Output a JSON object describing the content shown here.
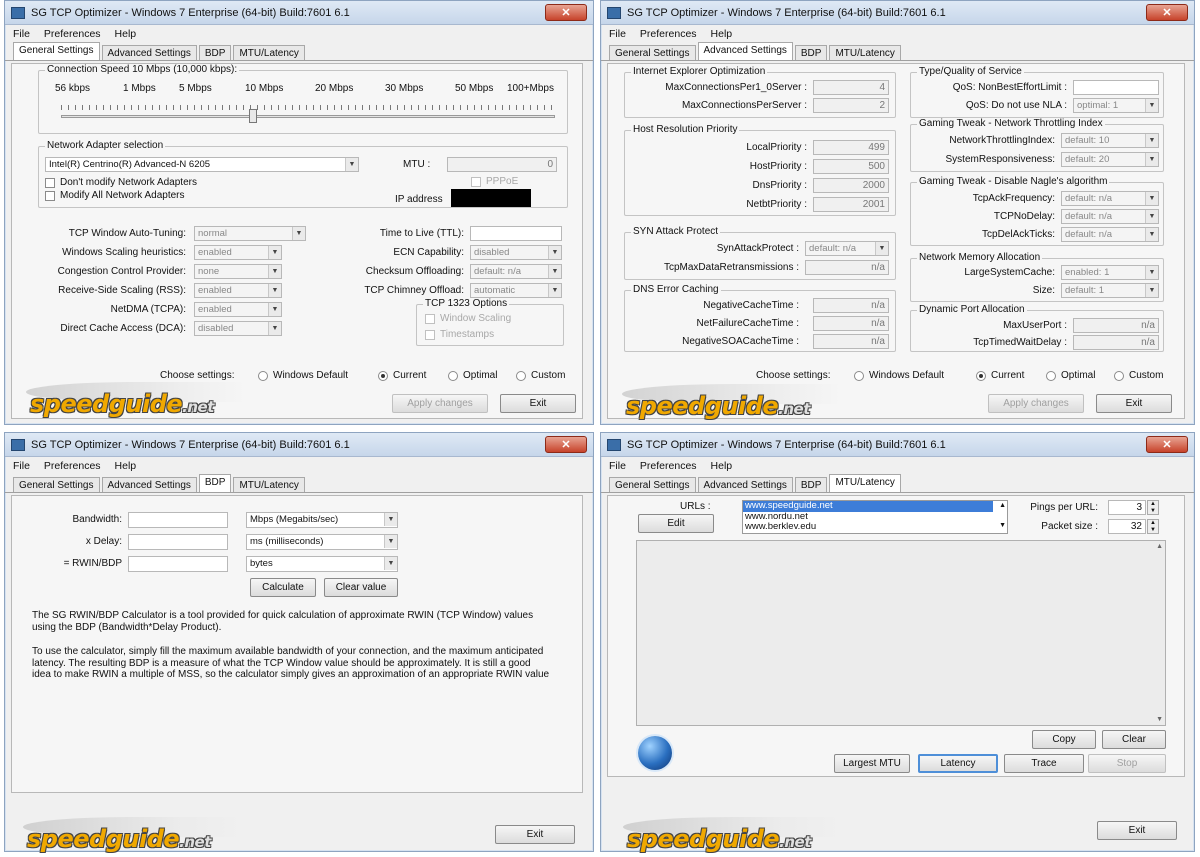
{
  "title": "SG TCP Optimizer - Windows 7 Enterprise (64-bit) Build:7601 6.1",
  "close_glyph": "✕",
  "menu": [
    "File",
    "Preferences",
    "Help"
  ],
  "tabs": [
    "General Settings",
    "Advanced Settings",
    "BDP",
    "MTU/Latency"
  ],
  "logo": {
    "text": "speedguide",
    "suffix": ".net"
  },
  "general": {
    "connection_speed_label": "Connection Speed  10 Mbps (10,000 kbps):",
    "speed_ticks": [
      "56 kbps",
      "1 Mbps",
      "5 Mbps",
      "10 Mbps",
      "20 Mbps",
      "30 Mbps",
      "50 Mbps",
      "100+Mbps"
    ],
    "slider_level": "10 Mbps",
    "adapter_group": "Network Adapter selection",
    "adapter": "Intel(R) Centrino(R) Advanced-N 6205",
    "dont_modify": "Don't modify Network Adapters",
    "modify_all": "Modify All Network Adapters",
    "mtu_label": "MTU :",
    "mtu_value": "0",
    "pppoe": "PPPoE",
    "ip_label": "IP address",
    "left_labels": [
      "TCP Window Auto-Tuning:",
      "Windows Scaling heuristics:",
      "Congestion Control Provider:",
      "Receive-Side Scaling (RSS):",
      "NetDMA (TCPA):",
      "Direct Cache Access (DCA):"
    ],
    "left_values": [
      "normal",
      "enabled",
      "none",
      "enabled",
      "enabled",
      "disabled"
    ],
    "right_labels": [
      "Time to Live (TTL):",
      "ECN Capability:",
      "Checksum Offloading:",
      "TCP Chimney Offload:"
    ],
    "right_values": [
      "",
      "disabled",
      "default: n/a",
      "automatic"
    ],
    "tcp1323": "TCP 1323 Options",
    "window_scaling": "Window Scaling",
    "timestamps": "Timestamps"
  },
  "choose": {
    "label": "Choose settings:",
    "options": [
      "Windows Default",
      "Current",
      "Optimal",
      "Custom"
    ],
    "selected": "Current"
  },
  "buttons": {
    "apply": "Apply changes",
    "exit": "Exit"
  },
  "advanced": {
    "ie_group": "Internet Explorer Optimization",
    "ie_labels": [
      "MaxConnectionsPer1_0Server :",
      "MaxConnectionsPerServer :"
    ],
    "ie_values": [
      "4",
      "2"
    ],
    "host_group": "Host Resolution Priority",
    "host_labels": [
      "LocalPriority :",
      "HostPriority :",
      "DnsPriority :",
      "NetbtPriority :"
    ],
    "host_values": [
      "499",
      "500",
      "2000",
      "2001"
    ],
    "syn_group": "SYN Attack Protect",
    "syn_labels": [
      "SynAttackProtect :",
      "TcpMaxDataRetransmissions :"
    ],
    "syn_values": [
      "default: n/a",
      "n/a"
    ],
    "dns_group": "DNS Error Caching",
    "dns_labels": [
      "NegativeCacheTime :",
      "NetFailureCacheTime :",
      "NegativeSOACacheTime :"
    ],
    "dns_values": [
      "n/a",
      "n/a",
      "n/a"
    ],
    "qos_group": "Type/Quality of Service",
    "qos_labels": [
      "QoS: NonBestEffortLimit :",
      "QoS: Do not use NLA :"
    ],
    "qos_values": [
      "",
      "optimal: 1"
    ],
    "thr_group": "Gaming Tweak - Network Throttling Index",
    "thr_labels": [
      "NetworkThrottlingIndex:",
      "SystemResponsiveness:"
    ],
    "thr_values": [
      "default: 10",
      "default: 20"
    ],
    "nagle_group": "Gaming Tweak - Disable Nagle's algorithm",
    "nagle_labels": [
      "TcpAckFrequency:",
      "TCPNoDelay:",
      "TcpDelAckTicks:"
    ],
    "nagle_values": [
      "default: n/a",
      "default: n/a",
      "default: n/a"
    ],
    "mem_group": "Network Memory Allocation",
    "mem_labels": [
      "LargeSystemCache:",
      "Size:"
    ],
    "mem_values": [
      "enabled: 1",
      "default: 1"
    ],
    "port_group": "Dynamic Port Allocation",
    "port_labels": [
      "MaxUserPort :",
      "TcpTimedWaitDelay :"
    ],
    "port_values": [
      "n/a",
      "n/a"
    ]
  },
  "bdp": {
    "labels": [
      "Bandwidth:",
      "x Delay:",
      "= RWIN/BDP"
    ],
    "units": [
      "Mbps (Megabits/sec)",
      "ms (milliseconds)",
      "bytes"
    ],
    "calculate": "Calculate",
    "clear": "Clear value",
    "desc1": "The SG RWIN/BDP Calculator is a tool provided for quick calculation of approximate RWIN (TCP Window) values using the BDP (Bandwidth*Delay Product).",
    "desc2": "To use the calculator, simply fill the maximum available bandwidth of your connection, and the maximum anticipated latency. The resulting BDP is a measure of what the TCP Window value should be approximately. It is still a good idea to make RWIN a multiple of MSS, so the calculator simply gives an approximation of an appropriate RWIN value"
  },
  "mtu": {
    "urls_label": "URLs :",
    "edit": "Edit",
    "urls": [
      "www.speedguide.net",
      "www.nordu.net",
      "www.berklev.edu"
    ],
    "pings_label": "Pings per URL:",
    "pings_value": "3",
    "packet_label": "Packet size :",
    "packet_value": "32",
    "copy": "Copy",
    "clear": "Clear",
    "largest_mtu": "Largest MTU",
    "latency": "Latency",
    "trace": "Trace",
    "stop": "Stop"
  }
}
